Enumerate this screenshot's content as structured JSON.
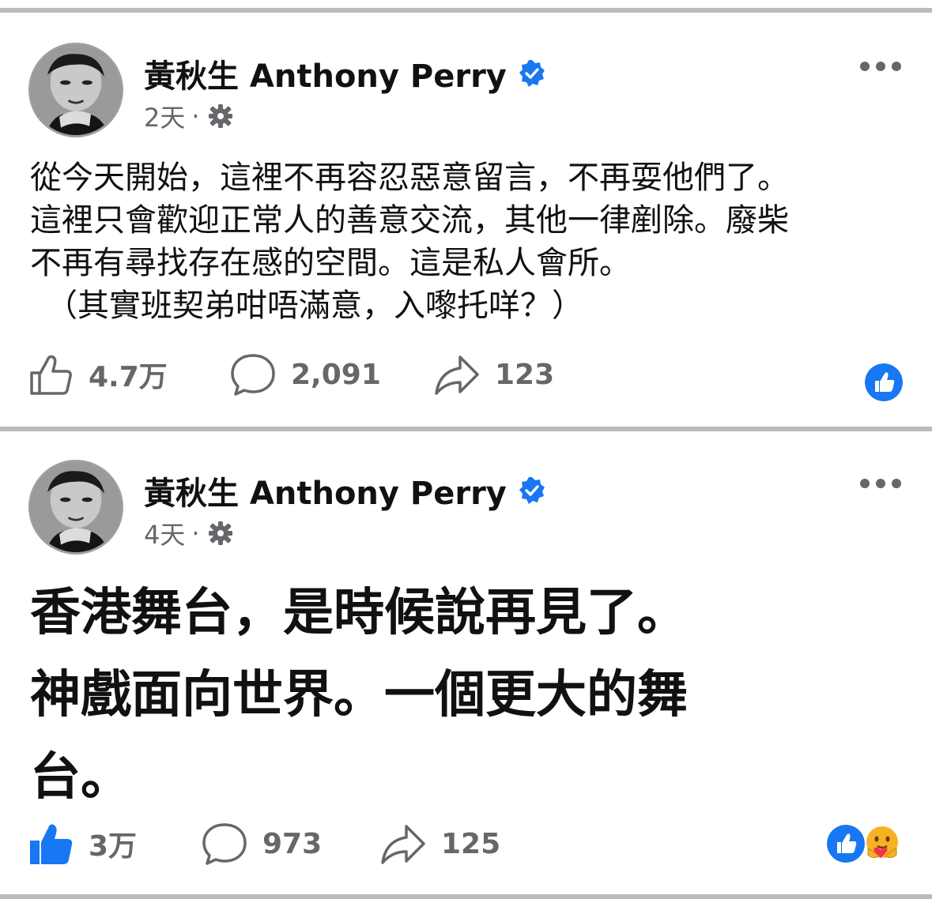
{
  "posts": [
    {
      "author": "黃秋生 Anthony Perry",
      "time": "2天",
      "separator": "·",
      "lines": [
        "從今天開始，這裡不再容忍惡意留言，不再耍他們了。",
        "這裡只會歡迎正常人的善意交流，其他一律剷除。廢柴",
        "不再有尋找存在感的空間。這是私人會所。",
        "　（其實班契弟咁唔滿意，入嚟托咩？）"
      ],
      "likes": "4.7万",
      "comments": "2,091",
      "shares": "123",
      "liked": false,
      "reactions": [
        "like"
      ]
    },
    {
      "author": "黃秋生 Anthony Perry",
      "time": "4天",
      "separator": "·",
      "lines": [
        "香港舞台，是時候說再見了。",
        "神戲面向世界。一個更大的舞",
        "台。"
      ],
      "likes": "3万",
      "comments": "973",
      "shares": "125",
      "liked": true,
      "reactions": [
        "like",
        "care"
      ]
    }
  ],
  "icons": {
    "verified": "verified-badge-icon",
    "privacy": "gear-icon",
    "more": "more-options-icon",
    "like": "thumbs-up-icon",
    "comment": "comment-bubble-icon",
    "share": "share-arrow-icon"
  },
  "colors": {
    "accent": "#1877f2",
    "muted": "#65676b",
    "divider": "#b9bbbe",
    "care": "#f7b125"
  }
}
